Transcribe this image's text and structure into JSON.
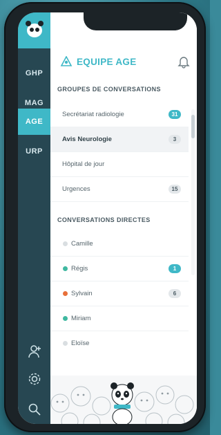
{
  "sidebar": {
    "tabs": [
      {
        "label": "GHP",
        "active": false
      },
      {
        "label": "MAG",
        "active": false
      },
      {
        "label": "AGE",
        "active": true
      },
      {
        "label": "URP",
        "active": false
      }
    ],
    "bottom_icons": [
      "user-add-icon",
      "gear-icon",
      "search-icon"
    ]
  },
  "header": {
    "title": "EQUIPE AGE",
    "team_icon": "team-icon",
    "bell_icon": "bell-icon"
  },
  "groups": {
    "title": "GROUPES DE CONVERSATIONS",
    "items": [
      {
        "label": "Secrétariat radiologie",
        "badge": "31",
        "badge_style": "teal",
        "selected": false
      },
      {
        "label": "Avis Neurologie",
        "badge": "3",
        "badge_style": "gray",
        "selected": true
      },
      {
        "label": "Hôpital de jour",
        "badge": "",
        "badge_style": "",
        "selected": false
      },
      {
        "label": "Urgences",
        "badge": "15",
        "badge_style": "gray",
        "selected": false
      }
    ]
  },
  "direct": {
    "title": "CONVERSATIONS DIRECTES",
    "items": [
      {
        "label": "Camille",
        "status_color": "#d9dee1",
        "badge": "",
        "badge_style": ""
      },
      {
        "label": "Régis",
        "status_color": "#3fb8a0",
        "badge": "1",
        "badge_style": "teal"
      },
      {
        "label": "Sylvain",
        "status_color": "#e8703a",
        "badge": "6",
        "badge_style": "gray"
      },
      {
        "label": "Miriam",
        "status_color": "#3fb8a0",
        "badge": "",
        "badge_style": ""
      },
      {
        "label": "Eloïse",
        "status_color": "#d9dee1",
        "badge": "",
        "badge_style": ""
      }
    ]
  },
  "colors": {
    "accent": "#3fb8c7",
    "sidebar": "#274752"
  }
}
